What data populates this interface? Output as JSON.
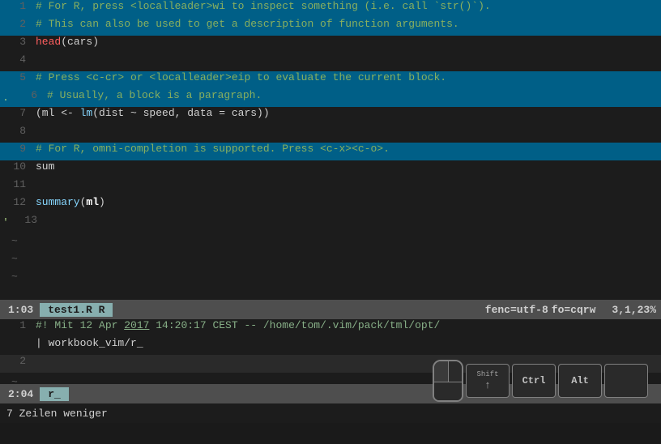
{
  "editor": {
    "lines": [
      {
        "num": "1",
        "content": "# For R, press <localleader>wi to inspect something (i.e. call `str()`).",
        "type": "comment",
        "highlight": "hl-blue"
      },
      {
        "num": "2",
        "content": "# This can also be used to get a description of function arguments.",
        "type": "comment",
        "highlight": "hl-blue"
      },
      {
        "num": "3",
        "content_parts": [
          {
            "text": "head",
            "class": "c-red-hl"
          },
          {
            "text": "(cars)",
            "class": "c-normal"
          }
        ],
        "highlight": ""
      },
      {
        "num": "4",
        "content": "",
        "highlight": ""
      },
      {
        "num": "5",
        "content": "# Press <c-cr> or <localleader>eip to evaluate the current block.",
        "type": "comment",
        "highlight": "hl-blue"
      },
      {
        "num": "6",
        "content": "# Usually, a block is a paragraph.",
        "type": "comment",
        "highlight": "hl-blue",
        "side_marker": "."
      },
      {
        "num": "7",
        "content_parts": [
          {
            "text": "(ml <- ",
            "class": "c-normal"
          },
          {
            "text": "lm",
            "class": "c-keyword"
          },
          {
            "text": "(dist ~ speed, data = cars))",
            "class": "c-normal"
          }
        ],
        "highlight": ""
      },
      {
        "num": "8",
        "content": "",
        "highlight": ""
      },
      {
        "num": "9",
        "content": "# For R, omni-completion is supported. Press <c-x><c-o>.",
        "type": "comment",
        "highlight": "hl-blue"
      },
      {
        "num": "10",
        "content": "sum",
        "highlight": ""
      },
      {
        "num": "11",
        "content": "",
        "highlight": ""
      },
      {
        "num": "12",
        "content_parts": [
          {
            "text": "summary",
            "class": "c-keyword"
          },
          {
            "text": "(",
            "class": "c-normal"
          },
          {
            "text": "ml",
            "class": "c-bold"
          },
          {
            "text": ")",
            "class": "c-normal"
          }
        ],
        "highlight": ""
      },
      {
        "num": "13",
        "content": "",
        "highlight": "",
        "side_marker": "'"
      }
    ],
    "tilde_lines": 3,
    "statusbar": {
      "mode": "1:03",
      "filename": "test1.R R",
      "fenc": "fenc=utf-8",
      "fo": "fo=cqrw",
      "position": "3,1,23%"
    }
  },
  "lower_editor": {
    "lines": [
      {
        "num": "1",
        "content": "#! Mit 12 Apr 2017 14:20:17 CEST -- /home/tom/.vim/pack/tml/opt/",
        "highlight": ""
      },
      {
        "num": "",
        "content": "| workbook_vim/r_",
        "highlight": ""
      },
      {
        "num": "2",
        "content": "",
        "highlight": ""
      }
    ],
    "tilde_lines": 1,
    "statusbar": {
      "mode": "2:04",
      "input": "r_"
    },
    "bottom_text": "7 Zeilen weniger"
  },
  "keyboard": {
    "shift_label_top": "Shift",
    "shift_arrow": "↑",
    "ctrl_label": "Ctrl",
    "alt_label": "Alt",
    "extra_label": ""
  }
}
